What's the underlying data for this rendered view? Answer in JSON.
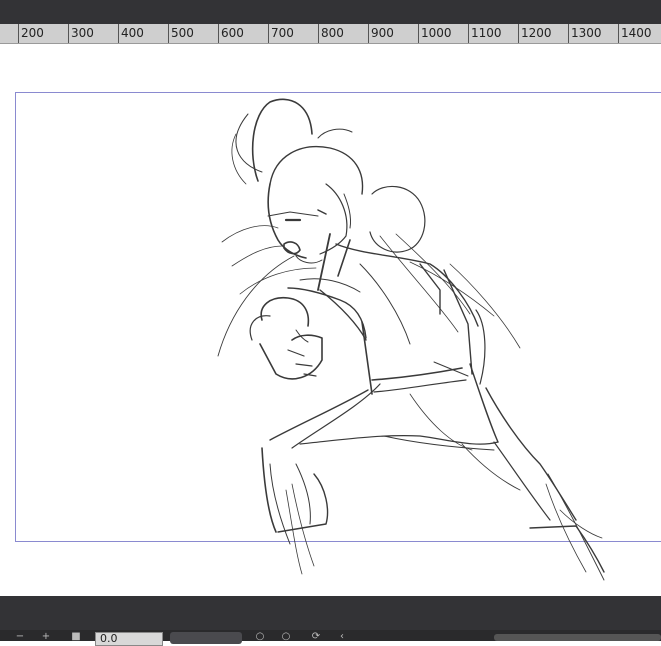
{
  "ruler": {
    "labels": [
      "200",
      "300",
      "400",
      "500",
      "600",
      "700",
      "800",
      "900",
      "1000",
      "1100",
      "1200",
      "1300",
      "1400"
    ]
  },
  "toolbar": {
    "zoom_value": "0.0",
    "icons": [
      "minus-icon",
      "plus-icon",
      "square-icon",
      "zoom-out-icon",
      "zoom-in-icon",
      "rotate-icon",
      "flip-icon"
    ]
  },
  "colors": {
    "chrome": "#333336",
    "ruler_bg": "#cfcfcf",
    "artboard_border": "#8a8ad0",
    "sketch_stroke": "#3a3a3a"
  }
}
